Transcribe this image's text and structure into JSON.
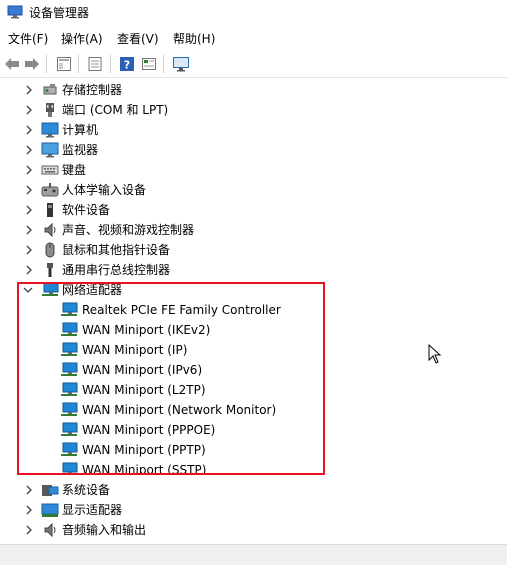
{
  "window": {
    "title": "设备管理器",
    "icon": "device-manager-icon"
  },
  "menu": [
    {
      "label": "文件(F)"
    },
    {
      "label": "操作(A)"
    },
    {
      "label": "查看(V)"
    },
    {
      "label": "帮助(H)"
    }
  ],
  "toolbar": {
    "icons": [
      "back-arrow-icon",
      "forward-arrow-icon",
      "properties-icon",
      "view-icon",
      "help-icon",
      "details-icon",
      "monitor-scan-icon"
    ]
  },
  "tree": {
    "categories_before": [
      {
        "label": "存储控制器",
        "icon": "storage-controller-icon",
        "expanded": false
      },
      {
        "label": "端口 (COM 和 LPT)",
        "icon": "port-icon",
        "expanded": false
      },
      {
        "label": "计算机",
        "icon": "computer-icon",
        "expanded": false
      },
      {
        "label": "监视器",
        "icon": "monitor-icon",
        "expanded": false
      },
      {
        "label": "键盘",
        "icon": "keyboard-icon",
        "expanded": false
      },
      {
        "label": "人体学输入设备",
        "icon": "hid-icon",
        "expanded": false
      },
      {
        "label": "软件设备",
        "icon": "software-device-icon",
        "expanded": false
      },
      {
        "label": "声音、视频和游戏控制器",
        "icon": "sound-icon",
        "expanded": false
      },
      {
        "label": "鼠标和其他指针设备",
        "icon": "mouse-icon",
        "expanded": false
      },
      {
        "label": "通用串行总线控制器",
        "icon": "usb-icon",
        "expanded": false
      }
    ],
    "network": {
      "label": "网络适配器",
      "icon": "network-adapter-icon",
      "expanded": true,
      "children": [
        "Realtek PCIe FE Family Controller",
        "WAN Miniport (IKEv2)",
        "WAN Miniport (IP)",
        "WAN Miniport (IPv6)",
        "WAN Miniport (L2TP)",
        "WAN Miniport (Network Monitor)",
        "WAN Miniport (PPPOE)",
        "WAN Miniport (PPTP)",
        "WAN Miniport (SSTP)"
      ]
    },
    "categories_after": [
      {
        "label": "系统设备",
        "icon": "system-device-icon",
        "expanded": false
      },
      {
        "label": "显示适配器",
        "icon": "display-adapter-icon",
        "expanded": false
      },
      {
        "label": "音频输入和输出",
        "icon": "audio-icon",
        "expanded": false
      }
    ]
  },
  "colors": {
    "highlight_border": "#e81123",
    "network_icon": "#1e88d6"
  }
}
